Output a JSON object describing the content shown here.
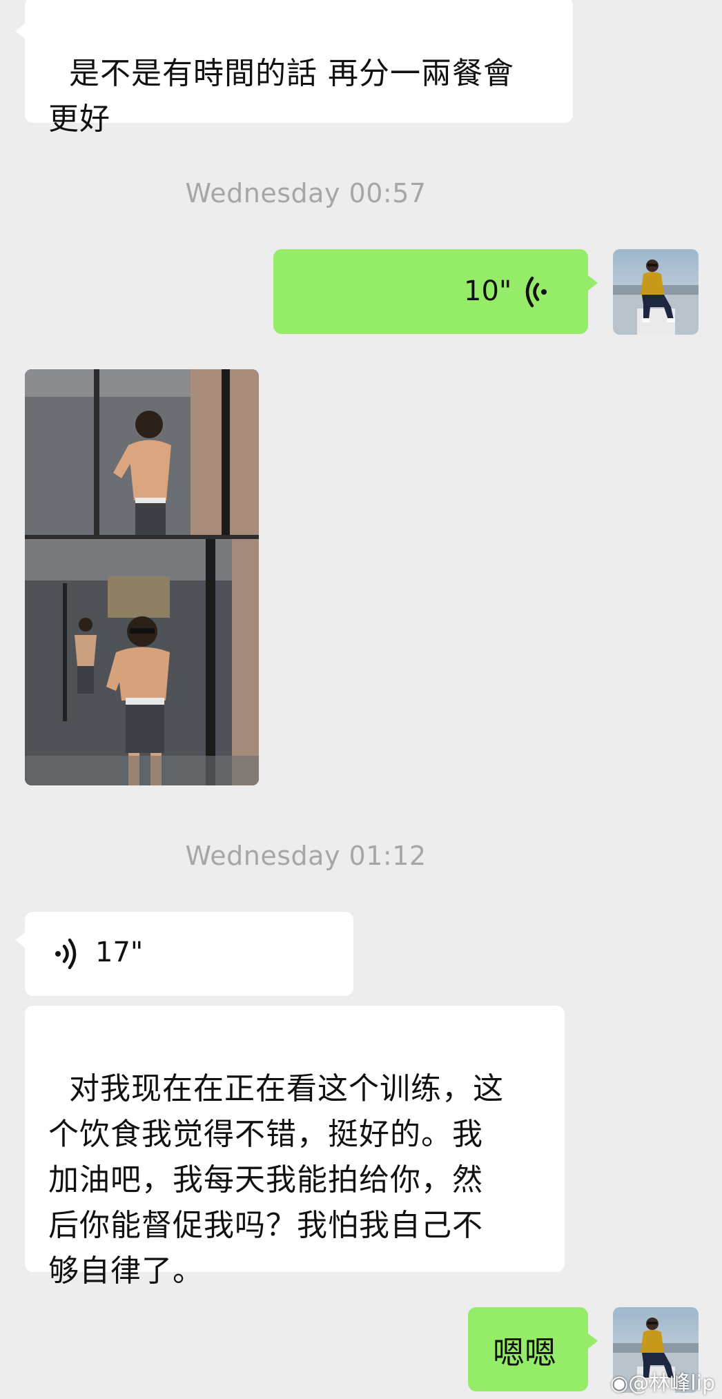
{
  "messages": {
    "m1_text": "是不是有時間的話 再分一兩餐會\n更好",
    "ts1": "Wednesday 00:57",
    "voice_out_duration": "10\"",
    "ts2": "Wednesday 01:12",
    "voice_in_duration": "17\"",
    "m2_text": "对我现在在正在看这个训练，这\n个饮食我觉得不错，挺好的。我\n加油吧，我每天我能拍给你，然\n后你能督促我吗？我怕我自己不\n够自律了。",
    "m3_text": "嗯嗯"
  },
  "watermark": "@林峰lip",
  "colors": {
    "background": "#ededed",
    "incoming_bubble": "#ffffff",
    "outgoing_bubble": "#95ec69",
    "timestamp": "#a6a6a6"
  },
  "icons": {
    "voice_out": "voice-wave-icon",
    "voice_in": "voice-wave-icon",
    "watermark": "weibo-icon"
  }
}
